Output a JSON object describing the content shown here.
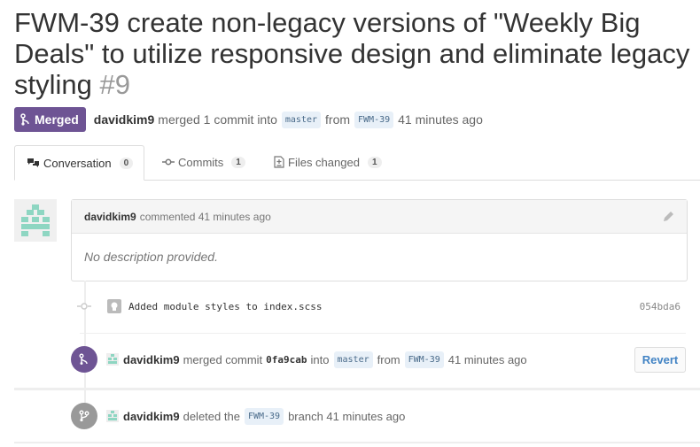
{
  "pr": {
    "title": "FWM-39 create non-legacy versions of \"Weekly Big Deals\" to utilize responsive design and eliminate legacy styling",
    "number": "#9",
    "status": "Merged",
    "author": "davidkim9",
    "merge_text": "merged 1 commit into",
    "base_branch": "master",
    "from_text": "from",
    "head_branch": "FWM-39",
    "time": "41 minutes ago"
  },
  "tabs": [
    {
      "label": "Conversation",
      "count": "0"
    },
    {
      "label": "Commits",
      "count": "1"
    },
    {
      "label": "Files changed",
      "count": "1"
    }
  ],
  "comment": {
    "author": "davidkim9",
    "action": "commented 41 minutes ago",
    "body": "No description provided."
  },
  "commit": {
    "message": "Added module styles to index.scss",
    "sha": "054bda6"
  },
  "merge_event": {
    "author": "davidkim9",
    "action": "merged commit",
    "sha": "0fa9cab",
    "into": "into",
    "base": "master",
    "from": "from",
    "head": "FWM-39",
    "time": "41 minutes ago",
    "revert_label": "Revert"
  },
  "delete_event": {
    "author": "davidkim9",
    "action": "deleted the",
    "branch": "FWM-39",
    "suffix": "branch 41 minutes ago"
  },
  "colors": {
    "merged_purple": "#6e5494",
    "deleted_gray": "#999999",
    "avatar_teal": "#8ed6c2",
    "link_blue": "#4183c4"
  }
}
